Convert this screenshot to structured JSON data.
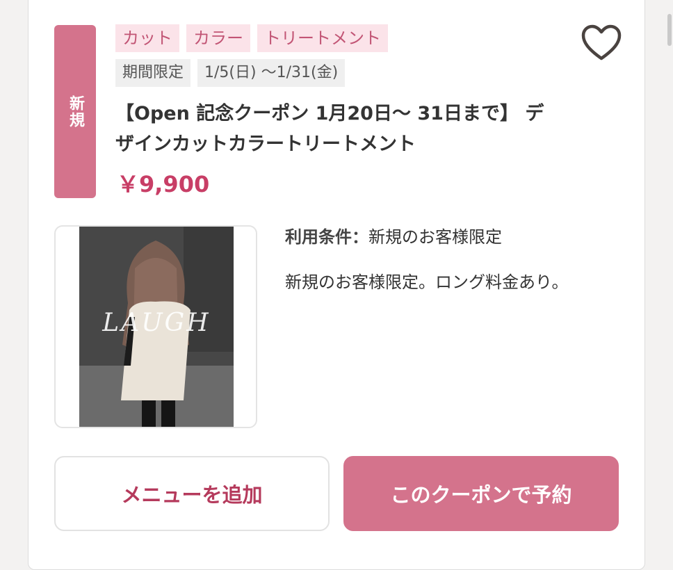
{
  "coupon": {
    "new_badge": "新規",
    "tags": [
      "カット",
      "カラー",
      "トリートメント"
    ],
    "period_label": "期間限定",
    "period_range": "1/5(日) 〜1/31(金)",
    "title": "【Open 記念クーポン 1月20日〜 31日まで】 デザインカットカラートリートメント",
    "price": "￥9,900",
    "photo_watermark": "LAUGH",
    "condition_label": "利用条件：",
    "condition_value": "新規のお客様限定",
    "description": "新規のお客様限定。ロング料金あり。",
    "add_menu_label": "メニューを追加",
    "reserve_label": "このクーポンで予約"
  },
  "colors": {
    "accent": "#d4738c",
    "price": "#c83e66",
    "tag_bg": "#fbe3e9",
    "period_bg": "#efefef"
  },
  "icons": {
    "favorite": "heart-outline-icon"
  }
}
